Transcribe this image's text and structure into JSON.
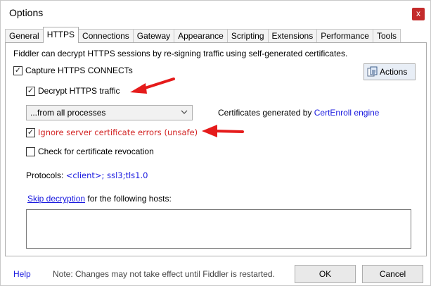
{
  "window": {
    "title": "Options",
    "close_label": "x"
  },
  "tabs": [
    {
      "label": "General",
      "active": false
    },
    {
      "label": "HTTPS",
      "active": true
    },
    {
      "label": "Connections",
      "active": false
    },
    {
      "label": "Gateway",
      "active": false
    },
    {
      "label": "Appearance",
      "active": false
    },
    {
      "label": "Scripting",
      "active": false
    },
    {
      "label": "Extensions",
      "active": false
    },
    {
      "label": "Performance",
      "active": false
    },
    {
      "label": "Tools",
      "active": false
    }
  ],
  "https": {
    "description": "Fiddler can decrypt HTTPS sessions by re-signing traffic using self-generated certificates.",
    "capture": {
      "label": "Capture HTTPS CONNECTs",
      "checked": true
    },
    "decrypt": {
      "label": "Decrypt HTTPS traffic",
      "checked": true
    },
    "process_dropdown": {
      "selected": "...from all processes"
    },
    "cert_text": "Certificates generated by ",
    "cert_engine": "CertEnroll engine",
    "ignore_errors": {
      "label": "Ignore server certificate errors (unsafe)",
      "checked": true
    },
    "revocation": {
      "label": "Check for certificate revocation",
      "checked": false
    },
    "protocols_label": "Protocols: ",
    "protocols_value": "<client>; ssl3;tls1.0",
    "skip_link": "Skip decryption",
    "skip_suffix": " for the following hosts:",
    "hosts_value": "",
    "actions_label": "Actions"
  },
  "footer": {
    "help": "Help",
    "note": "Note: Changes may not take effect until Fiddler is restarted.",
    "ok": "OK",
    "cancel": "Cancel"
  },
  "colors": {
    "accent_red": "#d22424",
    "link_blue": "#1a1adf",
    "close_red": "#c42b2b"
  },
  "icons": {
    "close": "close-icon",
    "actions": "actions-icon",
    "dropdown": "chevron-down-icon",
    "check": "check-icon",
    "annotation": "red-arrow-icon"
  }
}
